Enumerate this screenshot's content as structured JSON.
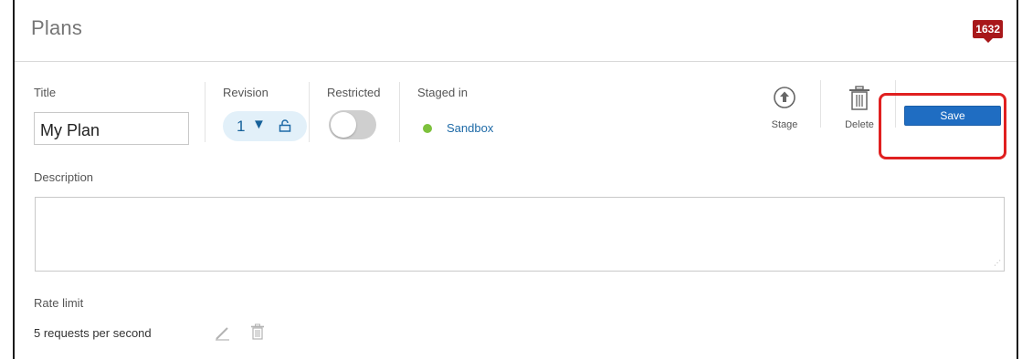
{
  "header": {
    "title": "Plans",
    "notification_count": "1632"
  },
  "form": {
    "title_label": "Title",
    "title_value": "My Plan",
    "revision_label": "Revision",
    "revision_value": "1",
    "revision_caret": "▼",
    "restricted_label": "Restricted",
    "restricted_on": false,
    "staged_label": "Staged in",
    "staged_env": "Sandbox",
    "staged_status_color": "#7dc13c"
  },
  "actions": {
    "stage_label": "Stage",
    "delete_label": "Delete",
    "save_label": "Save"
  },
  "description": {
    "label": "Description",
    "value": ""
  },
  "rate_limit": {
    "label": "Rate limit",
    "value": "5 requests per second"
  },
  "colors": {
    "accent": "#1f6dc2",
    "badge": "#a8181a",
    "highlight": "#e02020"
  }
}
